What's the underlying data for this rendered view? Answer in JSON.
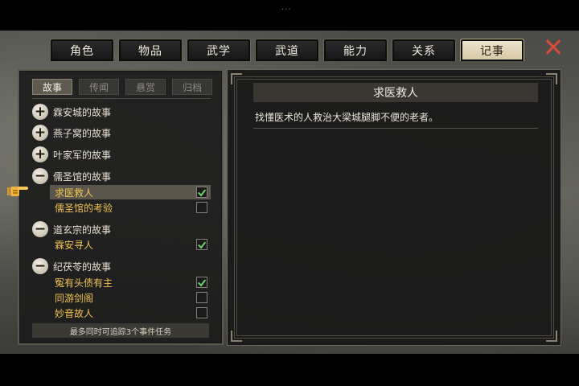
{
  "status": {
    "notch": "..."
  },
  "tabs": [
    {
      "label": "角色",
      "active": false
    },
    {
      "label": "物品",
      "active": false
    },
    {
      "label": "武学",
      "active": false
    },
    {
      "label": "武道",
      "active": false
    },
    {
      "label": "能力",
      "active": false
    },
    {
      "label": "关系",
      "active": false
    },
    {
      "label": "记事",
      "active": true
    }
  ],
  "close": {
    "icon": "close-x-icon",
    "symbol": "✕",
    "color": "#d54a3a"
  },
  "subtabs": [
    {
      "label": "故事",
      "active": true
    },
    {
      "label": "传闻",
      "active": false
    },
    {
      "label": "悬赏",
      "active": false
    },
    {
      "label": "归档",
      "active": false
    }
  ],
  "groups": [
    {
      "label": "霖安城的故事",
      "state": "+"
    },
    {
      "label": "燕子窝的故事",
      "state": "+"
    },
    {
      "label": "叶家军的故事",
      "state": "+"
    },
    {
      "label": "儒圣馆的故事",
      "state": "−"
    },
    {
      "label": "道玄宗的故事",
      "state": "−"
    },
    {
      "label": "纪茯苓的故事",
      "state": "−"
    }
  ],
  "items": [
    {
      "label": "求医救人",
      "checked": true,
      "selected": true
    },
    {
      "label": "儒圣馆的考验",
      "checked": false,
      "selected": false
    },
    {
      "label": "霖安寻人",
      "checked": true,
      "selected": false
    },
    {
      "label": "冤有头债有主",
      "checked": true,
      "selected": false
    },
    {
      "label": "同游剑阁",
      "checked": false,
      "selected": false
    },
    {
      "label": "妙音故人",
      "checked": false,
      "selected": false
    }
  ],
  "footer_note": "最多同时可追踪3个事件任务",
  "detail": {
    "title": "求医救人",
    "description": "找懂医术的人救治大梁城腿脚不便的老者。"
  },
  "colors": {
    "item_text": "#f1c453",
    "check": "#6ed06a",
    "active_tab": "#e6dcc0"
  }
}
